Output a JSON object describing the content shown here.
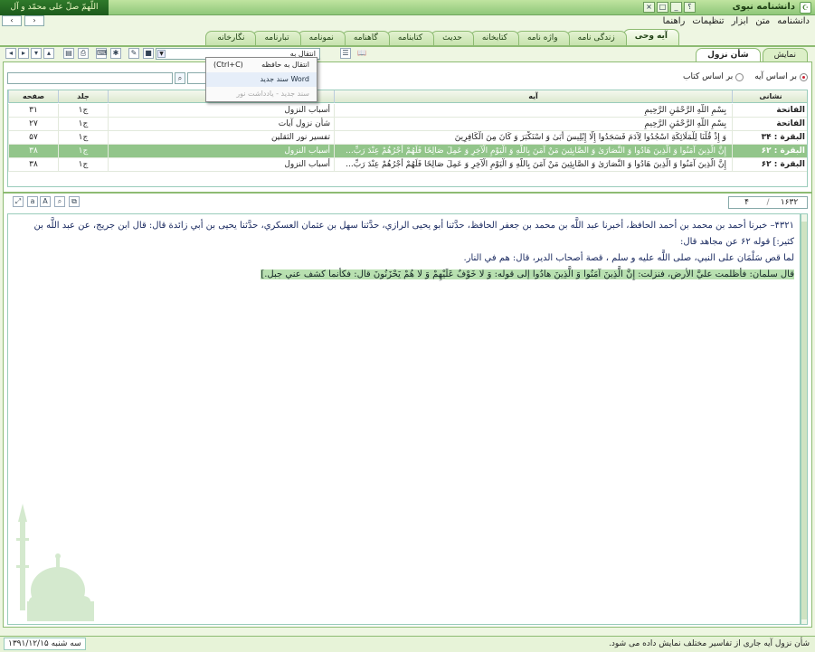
{
  "titlebar": {
    "title": "دانشنامه نبوی",
    "calligraphy": "اللّهمّ صلّ علی محمّد و آل محمّد",
    "help_label": "؟",
    "min_label": "_",
    "max_label": "□",
    "close_label": "×"
  },
  "menu": {
    "items": [
      "دانشنامه",
      "متن",
      "ابزار",
      "تنظیمات",
      "راهنما"
    ],
    "back_label": "›",
    "fwd_label": "‹"
  },
  "tabs": [
    "آیه وحی",
    "زندگی نامه",
    "واژه نامه",
    "کتابخانه",
    "حدیث",
    "کتابنامه",
    "گاهنامه",
    "نمونامه",
    "تبارنامه",
    "نگارخانه"
  ],
  "subtabs": [
    "نمایش",
    "شأن نزول"
  ],
  "toolbar": {
    "combo_label": "انتقال به",
    "icons": [
      "print-icon",
      "keyboard-icon",
      "bookmark-icon",
      "note-icon"
    ]
  },
  "popup": {
    "items": [
      {
        "label": "انتقال به حافظه",
        "key": "(Ctrl+C)"
      },
      {
        "label": "Word سند جدید",
        "key": ""
      },
      {
        "label": "سند جدید - یادداشت نور",
        "key": ""
      }
    ]
  },
  "filter": {
    "option_by_aya": "بر اساس آیه",
    "option_by_book": "بر اساس کتاب"
  },
  "grid": {
    "headers": {
      "sura": "نشانی",
      "aya": "آیه",
      "source": "",
      "vol": "جلد",
      "page": "صفحه"
    },
    "rows": [
      {
        "sura": "الفاتحة",
        "aya": "بِسْمِ اللَّهِ الرَّحْمَٰنِ الرَّحِيمِ",
        "source": "أسباب النزول",
        "vol": "ج۱",
        "page": "۳۱"
      },
      {
        "sura": "الفاتحة",
        "aya": "بِسْمِ اللَّهِ الرَّحْمَٰنِ الرَّحِيمِ",
        "source": "شأن نزول آيات",
        "vol": "ج۱",
        "page": "۲۷"
      },
      {
        "sura": "البقرة : ۳۴",
        "aya": "وَ إِذْ قُلْنَا لِلْمَلَائِكَةِ اسْجُدُوا لِآدَمَ فَسَجَدُوا إِلَّا إِبْلِيسَ أَبَىٰ وَ اسْتَكْبَرَ وَ كَانَ مِنَ الْكَافِرِينَ",
        "source": "تفسير نور الثقلين",
        "vol": "ج۱",
        "page": "۵۷"
      },
      {
        "sura": "البقرة : ۶۲",
        "aya": "إِنَّ الَّذِينَ آمَنُوا وَ الَّذِينَ هَادُوا وَ النَّصَارَىٰ وَ الصَّابِئِينَ مَنْ آمَنَ بِاللَّهِ وَ الْيَوْمِ الْآخِرِ وَ عَمِلَ صَالِحًا فَلَهُمْ أَجْرُهُمْ عِنْدَ رَبِّ...",
        "source": "أسباب النزول",
        "vol": "ج۱",
        "page": "۳۸"
      },
      {
        "sura": "البقرة : ۶۲",
        "aya": "إِنَّ الَّذِينَ آمَنُوا وَ الَّذِينَ هَادُوا وَ النَّصَارَىٰ وَ الصَّابِئِينَ مَنْ آمَنَ بِاللَّهِ وَ الْيَوْمِ الْآخِرِ وَ عَمِلَ صَالِحًا فَلَهُمْ أَجْرُهُمْ عِنْدَ رَبِّ...",
        "source": "أسباب النزول",
        "vol": "ج۱",
        "page": "۳۸"
      }
    ],
    "selected_index": 3
  },
  "pager": {
    "current": "۴",
    "total": "۱۶۳۲"
  },
  "text": {
    "para1": "۴۳۲۱– خبرنا أحمد بن محمد بن أحمد الحافظ، أخبرنا عبد اللَّه بن محمد بن جعفر الحافظ، حدَّثنا أبو يحيى الرازي، حدَّثنا سهل بن عثمان العسكري، حدَّثنا يحيى بن أبي زائدة قال: قال ابن جريج، عن عبد اللَّه بن كثير:] قوله ۶۲ عن مجاهد قال:",
    "para2": "لما قص سَلْمَان على النبي، صلى اللَّه عليه و سلم ، قصة أصحاب الدير، قال: هم في النار.",
    "para3": "قال سلمان: فأظلمت عليَّ الأرض، فنزلت: إِنَّ الَّذِينَ آمَنُوا وَ الَّذِينَ هادُوا إلى قوله: وَ لا خَوْفٌ عَلَيْهِمْ وَ لا هُمْ يَحْزَنُونَ قال: فكأنما كشف عني جبل.]"
  },
  "status": {
    "message": "شأن نزول آيه جاری از تفاسیر مختلف نمایش داده می شود.",
    "date": "سه شنبه ۱۳۹۱/۱۲/۱۵"
  },
  "colors": {
    "accent": "#8dbb72",
    "selection": "#92c58a",
    "text": "#1a2a60"
  }
}
